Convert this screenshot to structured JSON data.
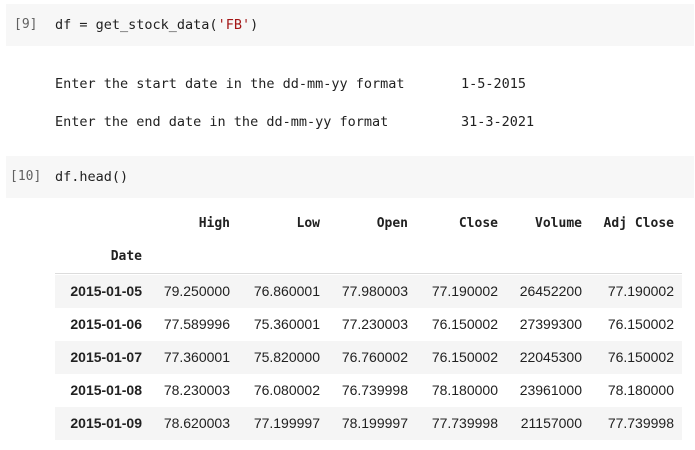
{
  "cell9": {
    "prompt": "[9]",
    "code_prefix": "df = get_stock_data(",
    "code_string": "'FB'",
    "code_suffix": ")"
  },
  "output9": {
    "start_prompt": "Enter the start date in the dd-mm-yy format",
    "start_value": "1-5-2015",
    "end_prompt": "Enter the end date in the dd-mm-yy format",
    "end_value": "31-3-2021"
  },
  "cell10": {
    "prompt": "[10]",
    "code": "df.head()"
  },
  "table": {
    "columns": [
      "High",
      "Low",
      "Open",
      "Close",
      "Volume",
      "Adj Close"
    ],
    "index_name": "Date",
    "rows": [
      {
        "date": "2015-01-05",
        "values": [
          "79.250000",
          "76.860001",
          "77.980003",
          "77.190002",
          "26452200",
          "77.190002"
        ]
      },
      {
        "date": "2015-01-06",
        "values": [
          "77.589996",
          "75.360001",
          "77.230003",
          "76.150002",
          "27399300",
          "76.150002"
        ]
      },
      {
        "date": "2015-01-07",
        "values": [
          "77.360001",
          "75.820000",
          "76.760002",
          "76.150002",
          "22045300",
          "76.150002"
        ]
      },
      {
        "date": "2015-01-08",
        "values": [
          "78.230003",
          "76.080002",
          "76.739998",
          "78.180000",
          "23961000",
          "78.180000"
        ]
      },
      {
        "date": "2015-01-09",
        "values": [
          "78.620003",
          "77.199997",
          "78.199997",
          "77.739998",
          "21157000",
          "77.739998"
        ]
      }
    ]
  }
}
